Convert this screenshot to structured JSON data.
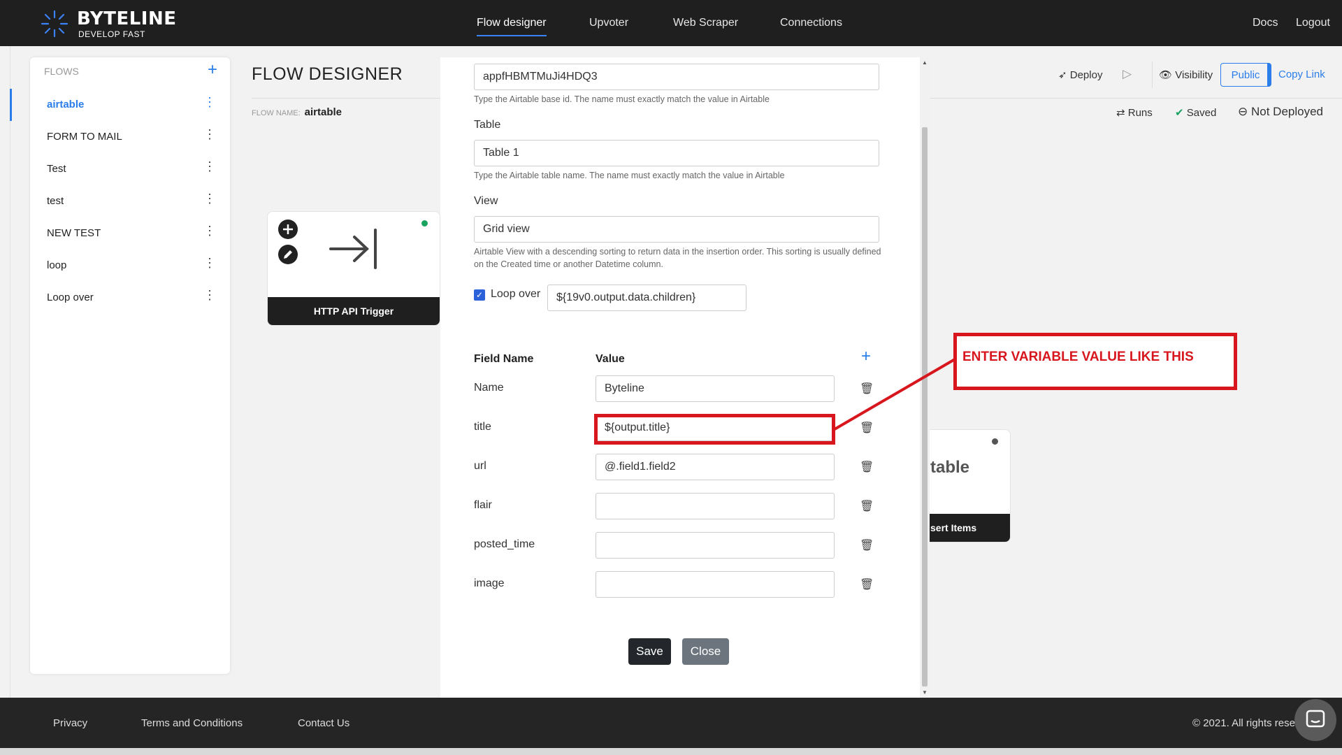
{
  "app": {
    "name": "BYTELINE",
    "tagline": "DEVELOP FAST",
    "nav": [
      "Flow designer",
      "Upvoter",
      "Web Scraper",
      "Connections"
    ],
    "right_links": [
      "Docs",
      "Logout"
    ]
  },
  "sidebar": {
    "header": "FLOWS",
    "items": [
      {
        "label": "airtable",
        "active": true
      },
      {
        "label": "FORM TO MAIL"
      },
      {
        "label": "Test"
      },
      {
        "label": "test"
      },
      {
        "label": "NEW TEST"
      },
      {
        "label": "loop"
      },
      {
        "label": "Loop over"
      }
    ]
  },
  "main": {
    "title": "FLOW DESIGNER",
    "flow_name_label": "FLOW NAME:",
    "flow_name": "airtable",
    "toolbar": {
      "deploy": "Deploy",
      "visibility": "Visibility",
      "public": "Public",
      "copy_link": "Copy Link"
    },
    "status": {
      "runs": "Runs",
      "saved": "Saved",
      "not_deployed": "Not Deployed"
    },
    "nodes": {
      "trigger": "HTTP API Trigger",
      "airtable_title": "table",
      "airtable_footer": "sert Items"
    }
  },
  "modal": {
    "base_id_value": "appfHBMTMuJi4HDQ3",
    "base_id_help": "Type the Airtable base id. The name must exactly match the value in Airtable",
    "table_label": "Table",
    "table_value": "Table 1",
    "table_help": "Type the Airtable table name. The name must exactly match the value in Airtable",
    "view_label": "View",
    "view_value": "Grid view",
    "view_help": "Airtable View with a descending sorting to return data in the insertion order. This sorting is usually defined on the Created time or another Datetime column.",
    "loop_label": "Loop over",
    "loop_value": "${19v0.output.data.children}",
    "col_field": "Field Name",
    "col_value": "Value",
    "fields": [
      {
        "name": "Name",
        "value": "Byteline"
      },
      {
        "name": "title",
        "value": "${output.title}"
      },
      {
        "name": "url",
        "value": "@.field1.field2"
      },
      {
        "name": "flair",
        "value": ""
      },
      {
        "name": "posted_time",
        "value": ""
      },
      {
        "name": "image",
        "value": ""
      }
    ],
    "save": "Save",
    "close": "Close"
  },
  "annotation": {
    "text": "ENTER VARIABLE VALUE LIKE THIS"
  },
  "footer": {
    "links": [
      "Privacy",
      "Terms and Conditions",
      "Contact Us"
    ],
    "copyright": "© 2021. All rights rese"
  },
  "colors": {
    "accent": "#2b7de9",
    "dark": "#1f1f1f",
    "highlight": "#d7161d",
    "node_status": "#1aa260"
  }
}
